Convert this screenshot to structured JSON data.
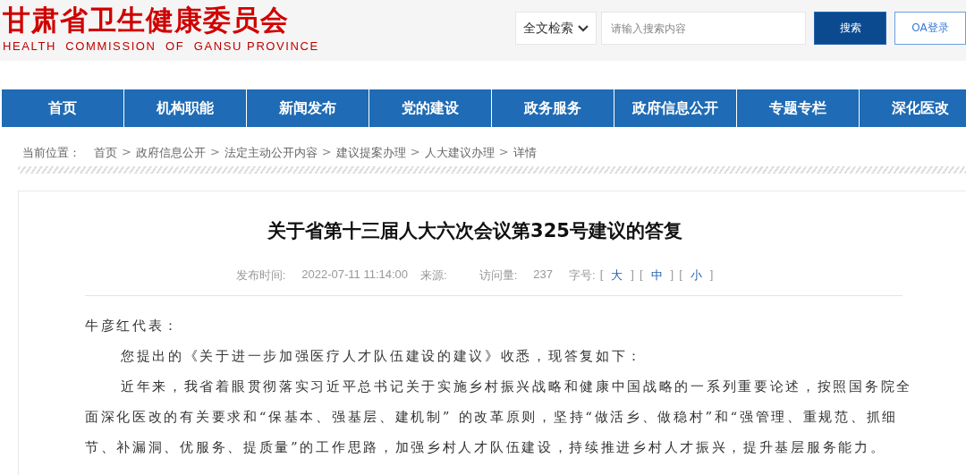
{
  "header": {
    "logo_cn": "甘肃省卫生健康委员会",
    "logo_en": "HEALTH  COMMISSION  OF  GANSU PROVINCE",
    "search_scope": "全文检索",
    "search_placeholder": "请输入搜索内容",
    "search_button": "搜索",
    "oa_button": "OA登录"
  },
  "nav": [
    {
      "label": "首页"
    },
    {
      "label": "机构职能"
    },
    {
      "label": "新闻发布"
    },
    {
      "label": "党的建设"
    },
    {
      "label": "政务服务"
    },
    {
      "label": "政府信息公开"
    },
    {
      "label": "专题专栏"
    },
    {
      "label": "深化医改"
    }
  ],
  "breadcrumb": {
    "label": "当前位置：",
    "separator": ">",
    "items": [
      "首页",
      "政府信息公开",
      "法定主动公开内容",
      "建议提案办理",
      "人大建议办理",
      "详情"
    ]
  },
  "article": {
    "title": "关于省第十三届人大六次会议第325号建议的答复",
    "meta": {
      "publish_label": "发布时间:",
      "publish_time": "2022-07-11 11:14:00",
      "source_label": "来源:",
      "views_label": "访问量:",
      "views": "237",
      "size_label": "字号:",
      "sizes": [
        "大",
        "中",
        "小"
      ],
      "bracket_open": "[",
      "bracket_close": "]"
    },
    "salutation": "牛彦红代表：",
    "paragraphs": [
      "您提出的《关于进一步加强医疗人才队伍建设的建议》收悉，现答复如下：",
      "近年来，我省着眼贯彻落实习近平总书记关于实施乡村振兴战略和健康中国战略的一系列重要论述，按照国务院全面深化医改的有关要求和“保基本、强基层、建机制” 的改革原则，坚持“做活乡、做稳村”和“强管理、重规范、抓细节、补漏洞、优服务、提质量”的工作思路，加强乡村人才队伍建设，持续推进乡村人才振兴，提升基层服务能力。"
    ]
  }
}
